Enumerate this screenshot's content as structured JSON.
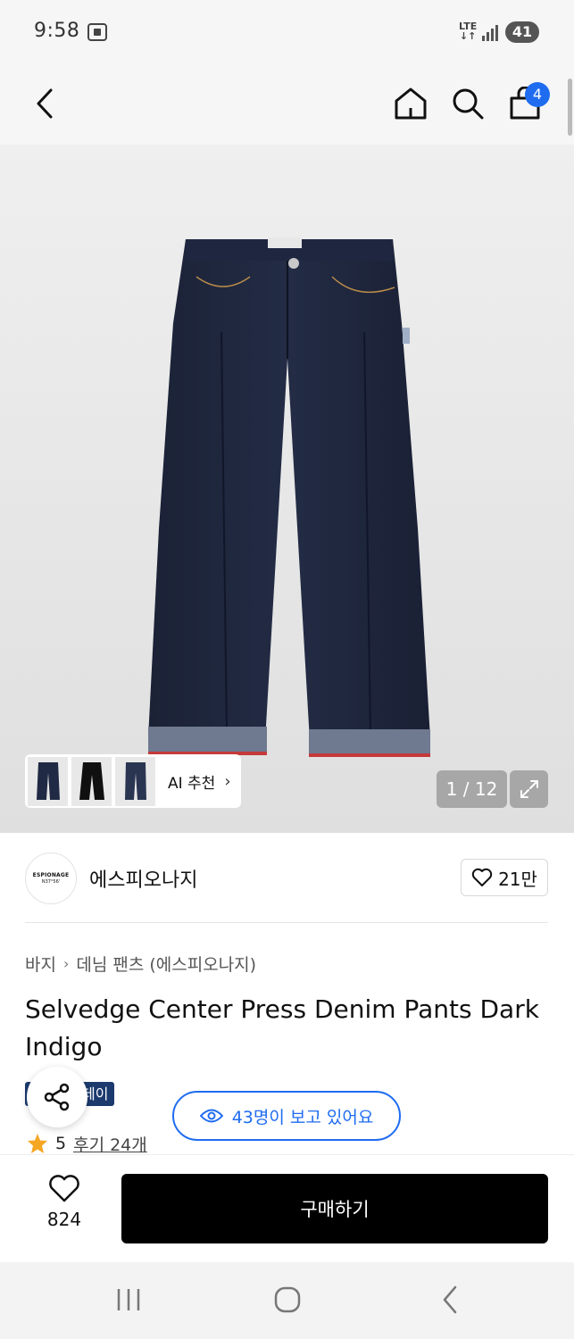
{
  "status_bar": {
    "time": "9:58",
    "network": "LTE",
    "battery": "41"
  },
  "nav": {
    "cart_count": "4"
  },
  "gallery": {
    "counter": "1 / 12",
    "ai_label": "AI 추천"
  },
  "brand": {
    "logo_main": "ESPIONAGE",
    "logo_sub": "N37°56'",
    "name": "에스피오나지",
    "likes": "21만"
  },
  "breadcrumb": {
    "category": "바지",
    "subcategory": "데님 팬츠 (에스피오나지)"
  },
  "product": {
    "title": "Selvedge Center Press Denim Pants Dark Indigo",
    "tag_partial": "데이",
    "viewers": "43명이 보고 있어요",
    "rating": "5",
    "reviews": "후기 24개"
  },
  "bottom_bar": {
    "like_count": "824",
    "buy_label": "구매하기"
  },
  "colors": {
    "accent": "#1f6cf0",
    "tag_bg": "#1c3a6e",
    "star": "#f5a623",
    "buy_button": "#000000"
  }
}
